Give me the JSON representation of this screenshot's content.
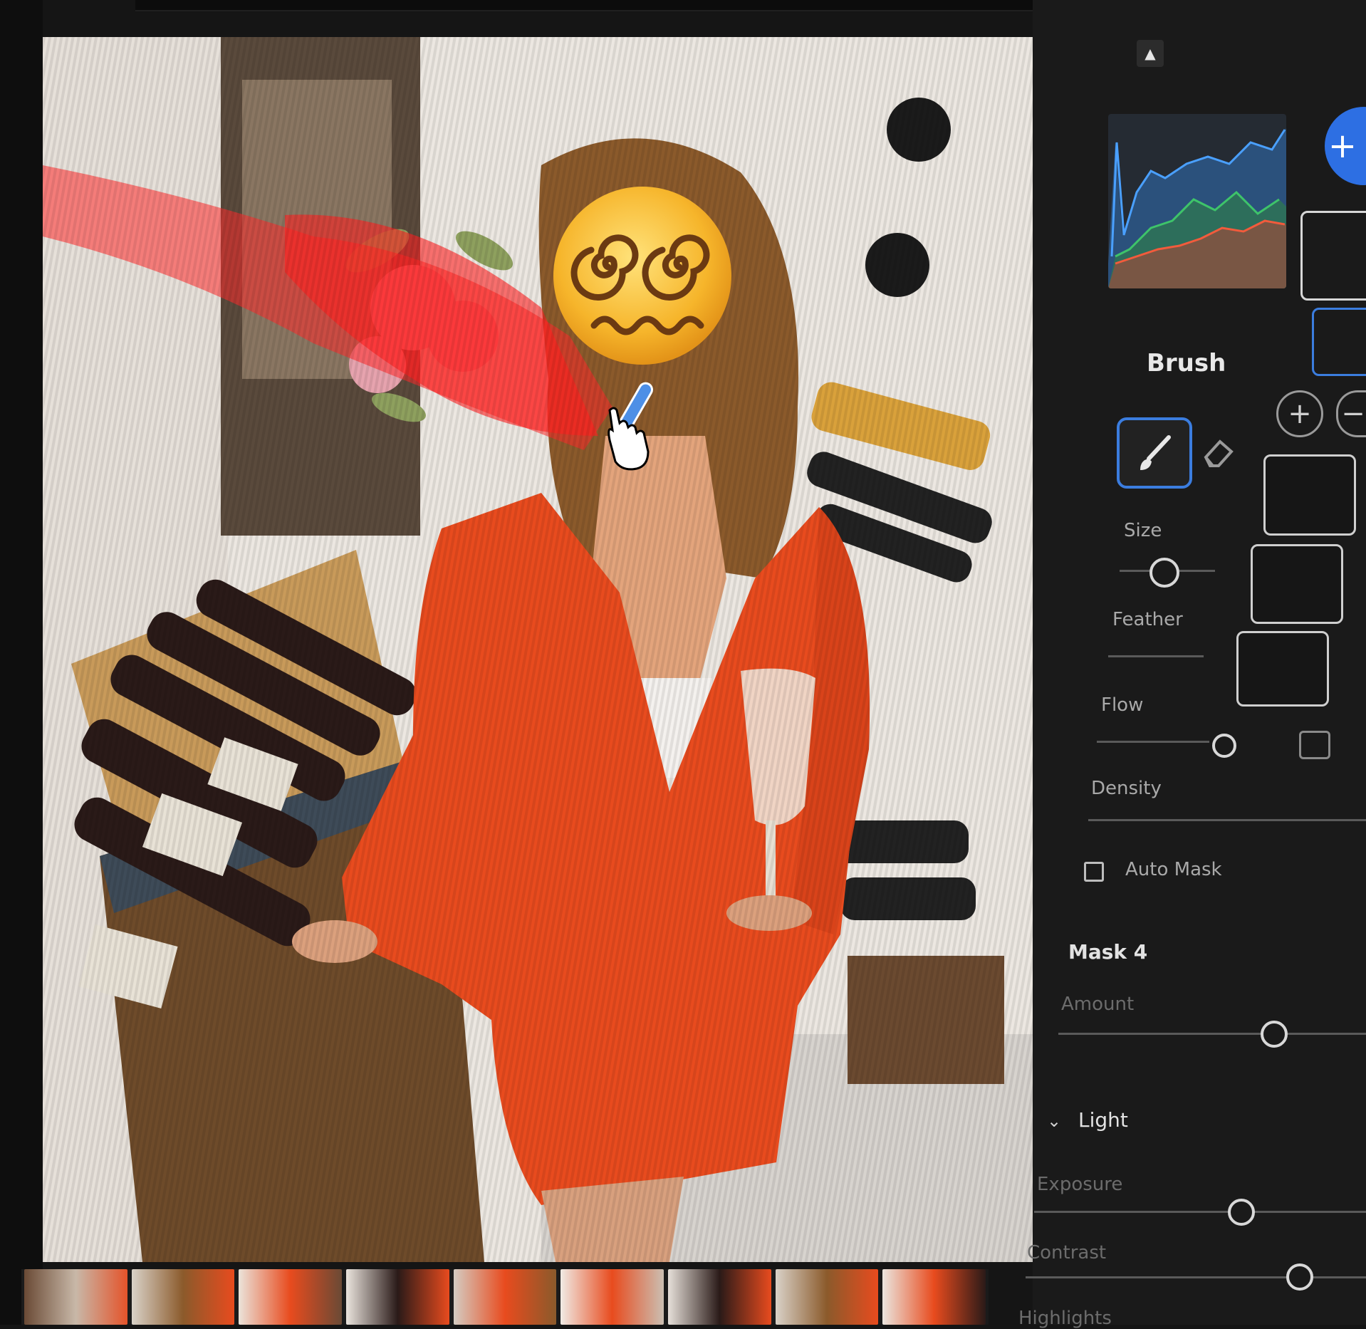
{
  "panel": {
    "tool_title": "Brush",
    "size_label": "Size",
    "feather_label": "Feather",
    "flow_label": "Flow",
    "density_label": "Density",
    "auto_mask_label": "Auto Mask",
    "auto_mask_checked": false,
    "mask_title": "Mask 4",
    "amount_label": "Amount",
    "light_section": "Light",
    "exposure_label": "Exposure",
    "contrast_label": "Contrast",
    "highlights_label": "Highlights",
    "add_icon": "plus-icon",
    "subtract_icon": "minus-icon",
    "collapse_icon": "triangle-up-icon"
  },
  "sliders": {
    "size": 0.5,
    "flow": 1.0,
    "amount": 0.5,
    "exposure": 0.5,
    "contrast": 0.5
  },
  "colors": {
    "accent": "#3b7ddf",
    "add_button": "#2d6fe3",
    "panel_bg": "#1a1a1a",
    "overlay": "#ff2a2a"
  },
  "filmstrip": {
    "count": 9
  }
}
